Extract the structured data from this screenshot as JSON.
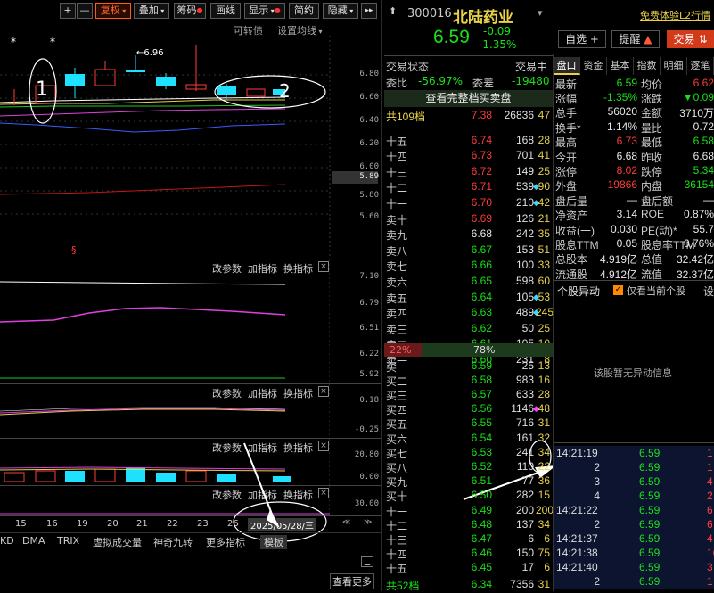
{
  "toolbar": {
    "plus": "+",
    "minus": "—",
    "fuquan": "复权",
    "diejia": "叠加",
    "chouma": "筹码",
    "huaxian": "画线",
    "xianshi": "显示",
    "jianyue": "简约",
    "yincang": "隐藏",
    "fullscreen": "▸▸",
    "kebe": "可转债",
    "setting": "设置均线"
  },
  "chart": {
    "price_labels": [
      "6.80",
      "6.60",
      "6.40",
      "6.20",
      "6.00",
      "5.89",
      "5.80",
      "5.60"
    ],
    "max_label": "6.96",
    "marker_s": "§",
    "ind1_labels": [
      "7.10",
      "6.79",
      "6.51",
      "6.22",
      "5.92"
    ],
    "ind2_labels": [
      "0.18",
      "-0.25"
    ],
    "ind3_labels": [
      "20.80",
      "0.00"
    ],
    "ind4_labels": [
      "30.00"
    ],
    "ind_btns": [
      "改参数",
      "加指标",
      "换指标"
    ],
    "close": "×",
    "dates": [
      "15",
      "16",
      "19",
      "20",
      "21",
      "22",
      "23",
      "26"
    ],
    "date_tip": "2025/05/28/三",
    "bottom_tabs": [
      "KD",
      "DMA",
      "TRIX",
      "虚拟成交量",
      "神奇九转",
      "更多指标",
      "模板"
    ],
    "view_more": "查看更多",
    "ann1": "1",
    "ann2": "2",
    "star": "*",
    "arrow_max": "←6.96"
  },
  "stock": {
    "code": "300016",
    "name": "北陆药业",
    "price": "6.59",
    "change": "-0.09",
    "pct": "-1.35%",
    "free_link": "免费体验L2行情",
    "zixuan": "自选 +",
    "tixing": "提醒",
    "jiaoyi": "交易"
  },
  "deal": {
    "status_label": "交易状态",
    "status": "交易中",
    "weibi_label": "委比",
    "weibi": "-56.97%",
    "weicha_label": "委差",
    "weicha": "-19480",
    "full": "查看完整档买卖盘",
    "top_label": "共109档",
    "top_price": "7.38",
    "top_vol": "26836",
    "top_num": "47",
    "bot_label": "共52档",
    "bot_price": "6.34",
    "bot_vol": "7356",
    "bot_num": "31",
    "buy_pct": "22%",
    "sell_pct": "78%"
  },
  "asks": [
    {
      "l": "十五",
      "p": "6.74",
      "v": "168",
      "d": "",
      "n": "28"
    },
    {
      "l": "十四",
      "p": "6.73",
      "v": "701",
      "d": "",
      "n": "41"
    },
    {
      "l": "十三",
      "p": "6.72",
      "v": "149",
      "d": "",
      "n": "25"
    },
    {
      "l": "十二",
      "p": "6.71",
      "v": "539",
      "d": "◆",
      "n": "90"
    },
    {
      "l": "十一",
      "p": "6.70",
      "v": "210",
      "d": "◆",
      "n": "42"
    },
    {
      "l": "卖十",
      "p": "6.69",
      "v": "126",
      "d": "",
      "n": "21"
    },
    {
      "l": "卖九",
      "p": "6.68",
      "v": "242",
      "d": "",
      "n": "35"
    },
    {
      "l": "卖八",
      "p": "6.67",
      "v": "153",
      "d": "",
      "n": "51"
    },
    {
      "l": "卖七",
      "p": "6.66",
      "v": "100",
      "d": "",
      "n": "33"
    },
    {
      "l": "卖六",
      "p": "6.65",
      "v": "598",
      "d": "",
      "n": "60"
    },
    {
      "l": "卖五",
      "p": "6.64",
      "v": "105",
      "d": "◆",
      "n": "53"
    },
    {
      "l": "卖四",
      "p": "6.63",
      "v": "489",
      "d": "◆",
      "n": "245"
    },
    {
      "l": "卖三",
      "p": "6.62",
      "v": "50",
      "d": "",
      "n": "25"
    },
    {
      "l": "卖二",
      "p": "6.61",
      "v": "105",
      "d": "",
      "n": "10"
    },
    {
      "l": "卖一",
      "p": "6.60",
      "v": "231",
      "d": "",
      "n": "8"
    }
  ],
  "bids": [
    {
      "l": "买一",
      "p": "6.59",
      "v": "25",
      "d": "",
      "n": "13"
    },
    {
      "l": "买二",
      "p": "6.58",
      "v": "983",
      "d": "",
      "n": "16"
    },
    {
      "l": "买三",
      "p": "6.57",
      "v": "633",
      "d": "",
      "n": "28"
    },
    {
      "l": "买四",
      "p": "6.56",
      "v": "1146",
      "d": "◆",
      "n": "48"
    },
    {
      "l": "买五",
      "p": "6.55",
      "v": "716",
      "d": "",
      "n": "31"
    },
    {
      "l": "买六",
      "p": "6.54",
      "v": "161",
      "d": "",
      "n": "32"
    },
    {
      "l": "买七",
      "p": "6.53",
      "v": "241",
      "d": "",
      "n": "34"
    },
    {
      "l": "买八",
      "p": "6.52",
      "v": "110",
      "d": "",
      "n": "22"
    },
    {
      "l": "买九",
      "p": "6.51",
      "v": "77",
      "d": "",
      "n": "36"
    },
    {
      "l": "买十",
      "p": "6.50",
      "v": "282",
      "d": "",
      "n": "15"
    },
    {
      "l": "十一",
      "p": "6.49",
      "v": "200",
      "d": "",
      "n": "200"
    },
    {
      "l": "十二",
      "p": "6.48",
      "v": "137",
      "d": "",
      "n": "34"
    },
    {
      "l": "十三",
      "p": "6.47",
      "v": "6",
      "d": "",
      "n": "6"
    },
    {
      "l": "十四",
      "p": "6.46",
      "v": "150",
      "d": "",
      "n": "75"
    },
    {
      "l": "十五",
      "p": "6.45",
      "v": "17",
      "d": "",
      "n": "6"
    }
  ],
  "tabs": [
    "盘口",
    "资金",
    "基本",
    "指数",
    "明细",
    "逐笔"
  ],
  "quote": [
    {
      "k1": "最新",
      "v1": "6.59",
      "k2": "均价",
      "v2": "6.62"
    },
    {
      "k1": "涨幅",
      "v1": "-1.35%",
      "k2": "涨跌",
      "v2": "▼0.09"
    },
    {
      "k1": "总手",
      "v1": "56020",
      "k2": "金额",
      "v2": "3710万"
    },
    {
      "k1": "换手*",
      "v1": "1.14%",
      "k2": "量比",
      "v2": "0.72"
    },
    {
      "k1": "最高",
      "v1": "6.73",
      "k2": "最低",
      "v2": "6.58"
    },
    {
      "k1": "今开",
      "v1": "6.68",
      "k2": "昨收",
      "v2": "6.68"
    },
    {
      "k1": "涨停",
      "v1": "8.02",
      "k2": "跌停",
      "v2": "5.34"
    },
    {
      "k1": "外盘",
      "v1": "19866",
      "k2": "内盘",
      "v2": "36154"
    },
    {
      "k1": "盘后量",
      "v1": "—",
      "k2": "盘后额",
      "v2": "—"
    },
    {
      "k1": "净资产",
      "v1": "3.14",
      "k2": "ROE",
      "v2": "0.87%"
    },
    {
      "k1": "收益(一)",
      "v1": "0.030",
      "k2": "PE(动)*",
      "v2": "55.7"
    },
    {
      "k1": "股息TTM",
      "v1": "0.05",
      "k2": "股息率TTM",
      "v2": "0.76%"
    },
    {
      "k1": "总股本",
      "v1": "4.919亿",
      "k2": "总值",
      "v2": "32.42亿"
    },
    {
      "k1": "流通股",
      "v1": "4.912亿",
      "k2": "流值",
      "v2": "32.37亿"
    }
  ],
  "yidong": {
    "title": "个股异动",
    "check": "仅看当前个股",
    "set": "设",
    "empty": "该股暂无异动信息"
  },
  "ticks": [
    {
      "t": "14:21:19",
      "p": "6.59",
      "v": "1"
    },
    {
      "t": "2",
      "p": "6.59",
      "v": "1"
    },
    {
      "t": "3",
      "p": "6.59",
      "v": "4"
    },
    {
      "t": "4",
      "p": "6.59",
      "v": "2"
    },
    {
      "t": "14:21:22",
      "p": "6.59",
      "v": "6"
    },
    {
      "t": "2",
      "p": "6.59",
      "v": "6"
    },
    {
      "t": "14:21:37",
      "p": "6.59",
      "v": "4"
    },
    {
      "t": "14:21:38",
      "p": "6.59",
      "v": "16"
    },
    {
      "t": "14:21:40",
      "p": "6.59",
      "v": "3"
    },
    {
      "t": "2",
      "p": "6.59",
      "v": "1"
    }
  ]
}
